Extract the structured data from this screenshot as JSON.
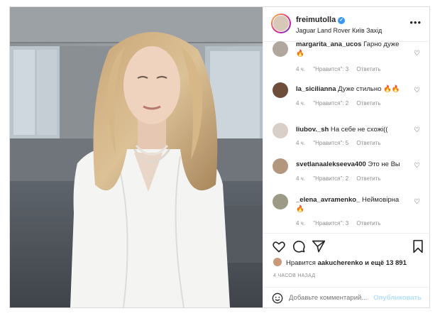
{
  "header": {
    "username": "freimutolla",
    "location": "Jaguar Land Rover Київ Захід",
    "more_icon": "more-horizontal-icon"
  },
  "comments": [
    {
      "username": "margarita_ana_ucos",
      "text": "Гарно дуже",
      "emoji": "🔥",
      "time": "4 ч.",
      "likes": "\"Нравится\": 3",
      "reply": "Ответить"
    },
    {
      "username": "la_sicilianna",
      "text": "Дуже стильно",
      "emoji": "🔥🔥",
      "time": "4 ч.",
      "likes": "\"Нравится\": 2",
      "reply": "Ответить"
    },
    {
      "username": "liubov._sh",
      "text": "На себе не схожі((",
      "emoji": "",
      "time": "4 ч.",
      "likes": "\"Нравится\": 5",
      "reply": "Ответить"
    },
    {
      "username": "svetlanaalekseeva400",
      "text": "Это не Вы",
      "emoji": "",
      "time": "4 ч.",
      "likes": "\"Нравится\": 2",
      "reply": "Ответить"
    },
    {
      "username": "_elena_avramenko_",
      "text": "Неймовірна",
      "emoji": "🔥",
      "time": "4 ч.",
      "likes": "\"Нравится\": 3",
      "reply": "Ответить"
    }
  ],
  "likes": {
    "prefix": "Нравится",
    "user": "aakucherenko",
    "suffix": "и ещё 13 891"
  },
  "time_ago": "4 ЧАСОВ НАЗАД",
  "add_comment": {
    "placeholder": "Добавьте комментарий...",
    "post_label": "Опубликовать"
  },
  "icons": [
    "heart-icon",
    "comment-icon",
    "share-icon",
    "bookmark-icon",
    "emoji-icon"
  ]
}
